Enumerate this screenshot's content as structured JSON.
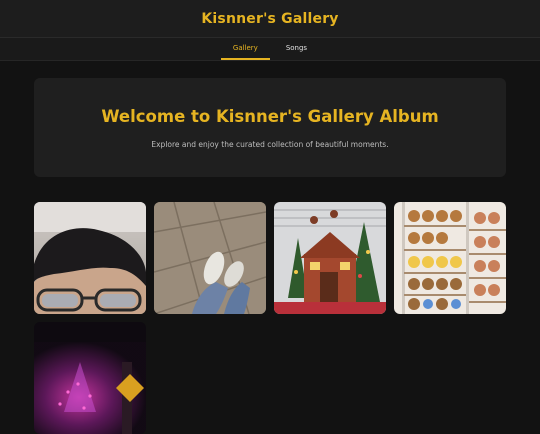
{
  "header": {
    "brand": "Kisnner's Gallery"
  },
  "nav": {
    "tabs": [
      {
        "label": "Gallery",
        "active": true
      },
      {
        "label": "Songs",
        "active": false
      }
    ]
  },
  "hero": {
    "title": "Welcome to Kisnner's Gallery Album",
    "subtitle": "Explore and enjoy the curated collection of beautiful moments."
  },
  "gallery": {
    "photos": [
      {
        "subject": "selfie-with-glasses"
      },
      {
        "subject": "feet-on-tiled-floor"
      },
      {
        "subject": "christmas-gingerbread-house-display"
      },
      {
        "subject": "plush-toys-on-shelves"
      },
      {
        "subject": "pink-neon-night-scene"
      }
    ]
  },
  "colors": {
    "accent": "#e6b422",
    "background": "#121212",
    "card": "#1f1f1f"
  }
}
